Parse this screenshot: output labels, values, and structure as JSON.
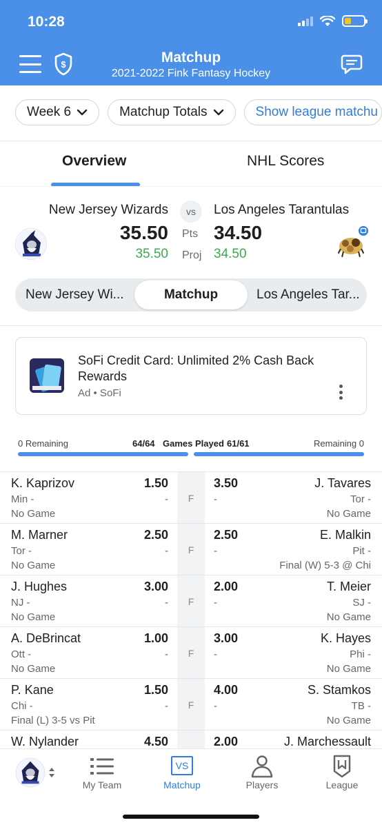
{
  "status": {
    "time": "10:28"
  },
  "header": {
    "title": "Matchup",
    "subtitle": "2021-2022 Fink Fantasy Hockey"
  },
  "filters": {
    "week": "Week 6",
    "totals": "Matchup Totals",
    "show_league": "Show league matchu"
  },
  "tabs": [
    {
      "label": "Overview"
    },
    {
      "label": "NHL Scores"
    }
  ],
  "matchup": {
    "vs": "vs",
    "pts_label": "Pts",
    "proj_label": "Proj",
    "home": {
      "name": "New Jersey Wizards",
      "score": "35.50",
      "proj": "35.50"
    },
    "away": {
      "name": "Los Angeles Tarantulas",
      "score": "34.50",
      "proj": "34.50"
    }
  },
  "segmented": {
    "left": "New Jersey Wi...",
    "center": "Matchup",
    "right": "Los Angeles Tar..."
  },
  "ad": {
    "title": "SoFi Credit Card: Unlimited 2% Cash Back Rewards",
    "meta": "Ad • SoFi"
  },
  "games": {
    "left_remaining": "0 Remaining",
    "left_count": "64/64",
    "label": "Games Played",
    "right_count": "61/61",
    "right_remaining": "Remaining 0"
  },
  "rows": [
    {
      "status": "F",
      "left": {
        "name": "K. Kaprizov",
        "pts": "1.50",
        "team": "Min -",
        "dash": "-",
        "game": "No Game"
      },
      "right": {
        "name": "J. Tavares",
        "pts": "3.50",
        "team": "Tor -",
        "dash": "-",
        "game": "No Game"
      }
    },
    {
      "status": "F",
      "left": {
        "name": "M. Marner",
        "pts": "2.50",
        "team": "Tor -",
        "dash": "-",
        "game": "No Game"
      },
      "right": {
        "name": "E. Malkin",
        "pts": "2.50",
        "team": "Pit -",
        "dash": "-",
        "game": "Final (W) 5-3 @ Chi"
      }
    },
    {
      "status": "F",
      "left": {
        "name": "J. Hughes",
        "pts": "3.00",
        "team": "NJ -",
        "dash": "-",
        "game": "No Game"
      },
      "right": {
        "name": "T. Meier",
        "pts": "2.00",
        "team": "SJ -",
        "dash": "-",
        "game": "No Game"
      }
    },
    {
      "status": "F",
      "left": {
        "name": "A. DeBrincat",
        "pts": "1.00",
        "team": "Ott -",
        "dash": "-",
        "game": "No Game"
      },
      "right": {
        "name": "K. Hayes",
        "pts": "3.00",
        "team": "Phi -",
        "dash": "-",
        "game": "No Game"
      }
    },
    {
      "status": "F",
      "left": {
        "name": "P. Kane",
        "pts": "1.50",
        "team": "Chi -",
        "dash": "-",
        "game": "Final (L) 3-5 vs Pit"
      },
      "right": {
        "name": "S. Stamkos",
        "pts": "4.00",
        "team": "TB -",
        "dash": "-",
        "game": "No Game"
      }
    },
    {
      "status": "",
      "left": {
        "name": "W. Nylander",
        "pts": "4.50",
        "team": "",
        "dash": "",
        "game": ""
      },
      "right": {
        "name": "J. Marchessault",
        "pts": "2.00",
        "team": "",
        "dash": "",
        "game": ""
      }
    }
  ],
  "nav": {
    "my_team": "My Team",
    "matchup": "Matchup",
    "players": "Players",
    "league": "League",
    "vs_icon_text": "VS"
  },
  "colors": {
    "accent": "#4a8fe8",
    "link": "#2e7ddf",
    "proj_green": "#3aaa4e"
  }
}
